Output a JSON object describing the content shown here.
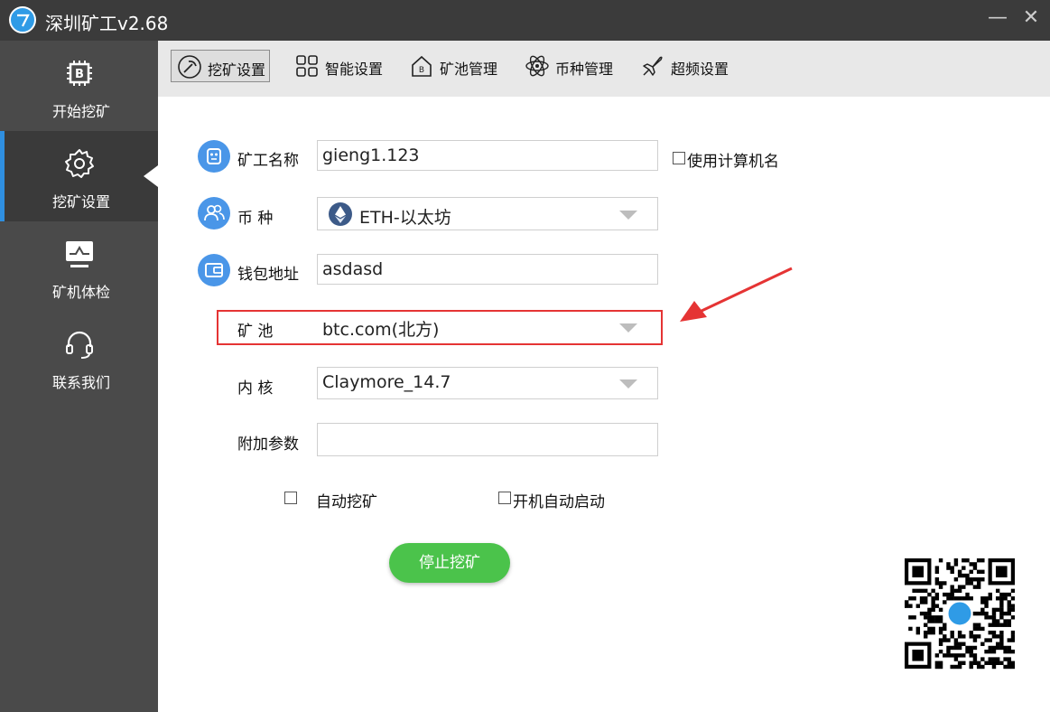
{
  "app": {
    "title": "深圳矿工v2.68",
    "minimize_label": "—",
    "close_label": "✕"
  },
  "sidebar": {
    "items": [
      {
        "label": "开始挖矿",
        "icon": "bitcoin-chip-icon"
      },
      {
        "label": "挖矿设置",
        "icon": "gear-icon"
      },
      {
        "label": "矿机体检",
        "icon": "monitor-pulse-icon"
      },
      {
        "label": "联系我们",
        "icon": "headset-icon"
      }
    ],
    "active_index": 1
  },
  "tabs": [
    {
      "label": "挖矿设置",
      "icon": "pickaxe-icon"
    },
    {
      "label": "智能设置",
      "icon": "grid-icon"
    },
    {
      "label": "矿池管理",
      "icon": "bitcoin-house-icon"
    },
    {
      "label": "币种管理",
      "icon": "atom-icon"
    },
    {
      "label": "超频设置",
      "icon": "jet-icon"
    }
  ],
  "form": {
    "miner_name": {
      "label": "矿工名称",
      "value": "gieng1.123",
      "icon": "robot-icon"
    },
    "use_computer_name": {
      "label": "使用计算机名",
      "checked": false
    },
    "coin": {
      "label": "币 种",
      "value": "ETH-以太坊",
      "icon": "users-icon",
      "coin_icon": "ethereum-icon"
    },
    "wallet": {
      "label": "钱包地址",
      "value": "asdasd",
      "icon": "wallet-icon"
    },
    "pool": {
      "label": "矿 池",
      "value": "btc.com(北方)"
    },
    "kernel": {
      "label": "内 核",
      "value": "Claymore_14.7"
    },
    "extra_params": {
      "label": "附加参数",
      "value": ""
    },
    "auto_mine": {
      "label": "自动挖矿",
      "checked": false
    },
    "auto_start": {
      "label": "开机自动启动",
      "checked": false
    }
  },
  "stop_button": {
    "label": "停止挖矿"
  },
  "colors": {
    "accent_blue": "#4a96e8",
    "stop_green": "#4bc34b",
    "highlight_red": "#e53434",
    "sidebar_bg": "#4a4a4a",
    "titlebar_bg": "#3b3b3b"
  }
}
